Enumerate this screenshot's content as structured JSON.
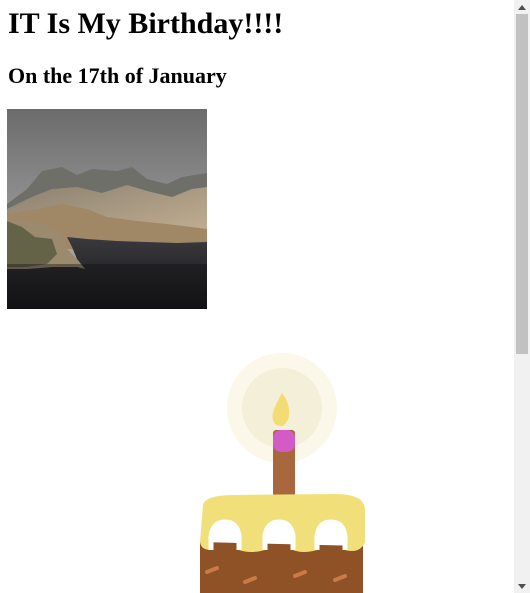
{
  "page": {
    "heading": "IT Is My Birthday!!!!",
    "subheading": "On the 17th of January"
  },
  "images": {
    "photo": "landscape-photo",
    "cake": "birthday-cake-illustration"
  },
  "colors": {
    "background": "#ffffff",
    "frosting": "#f1e07a",
    "cake_body": "#8f5126",
    "candle": "#a8673d",
    "candle_tip": "#d25bc5",
    "flame": "#f3dc74",
    "glow": "#f8f4e0"
  }
}
